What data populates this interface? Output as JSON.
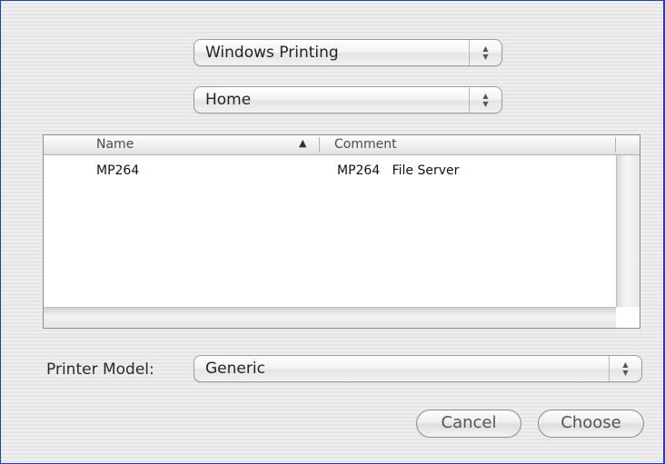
{
  "service_popup": {
    "value": "Windows Printing"
  },
  "group_popup": {
    "value": "Home"
  },
  "browser": {
    "columns": {
      "name": "Name",
      "sort_indicator": "▲",
      "comment": "Comment"
    },
    "rows": [
      {
        "name": "MP264",
        "comment": "MP264   File Server"
      }
    ]
  },
  "printer_model": {
    "label": "Printer Model:",
    "value": "Generic"
  },
  "buttons": {
    "cancel": "Cancel",
    "choose": "Choose"
  },
  "icons": {
    "popup_arrows": "up-down-arrows-icon",
    "sort": "sort-ascending-icon"
  },
  "colors": {
    "frame_accent": "#1a3fd0",
    "window_bg": "#ececec"
  }
}
